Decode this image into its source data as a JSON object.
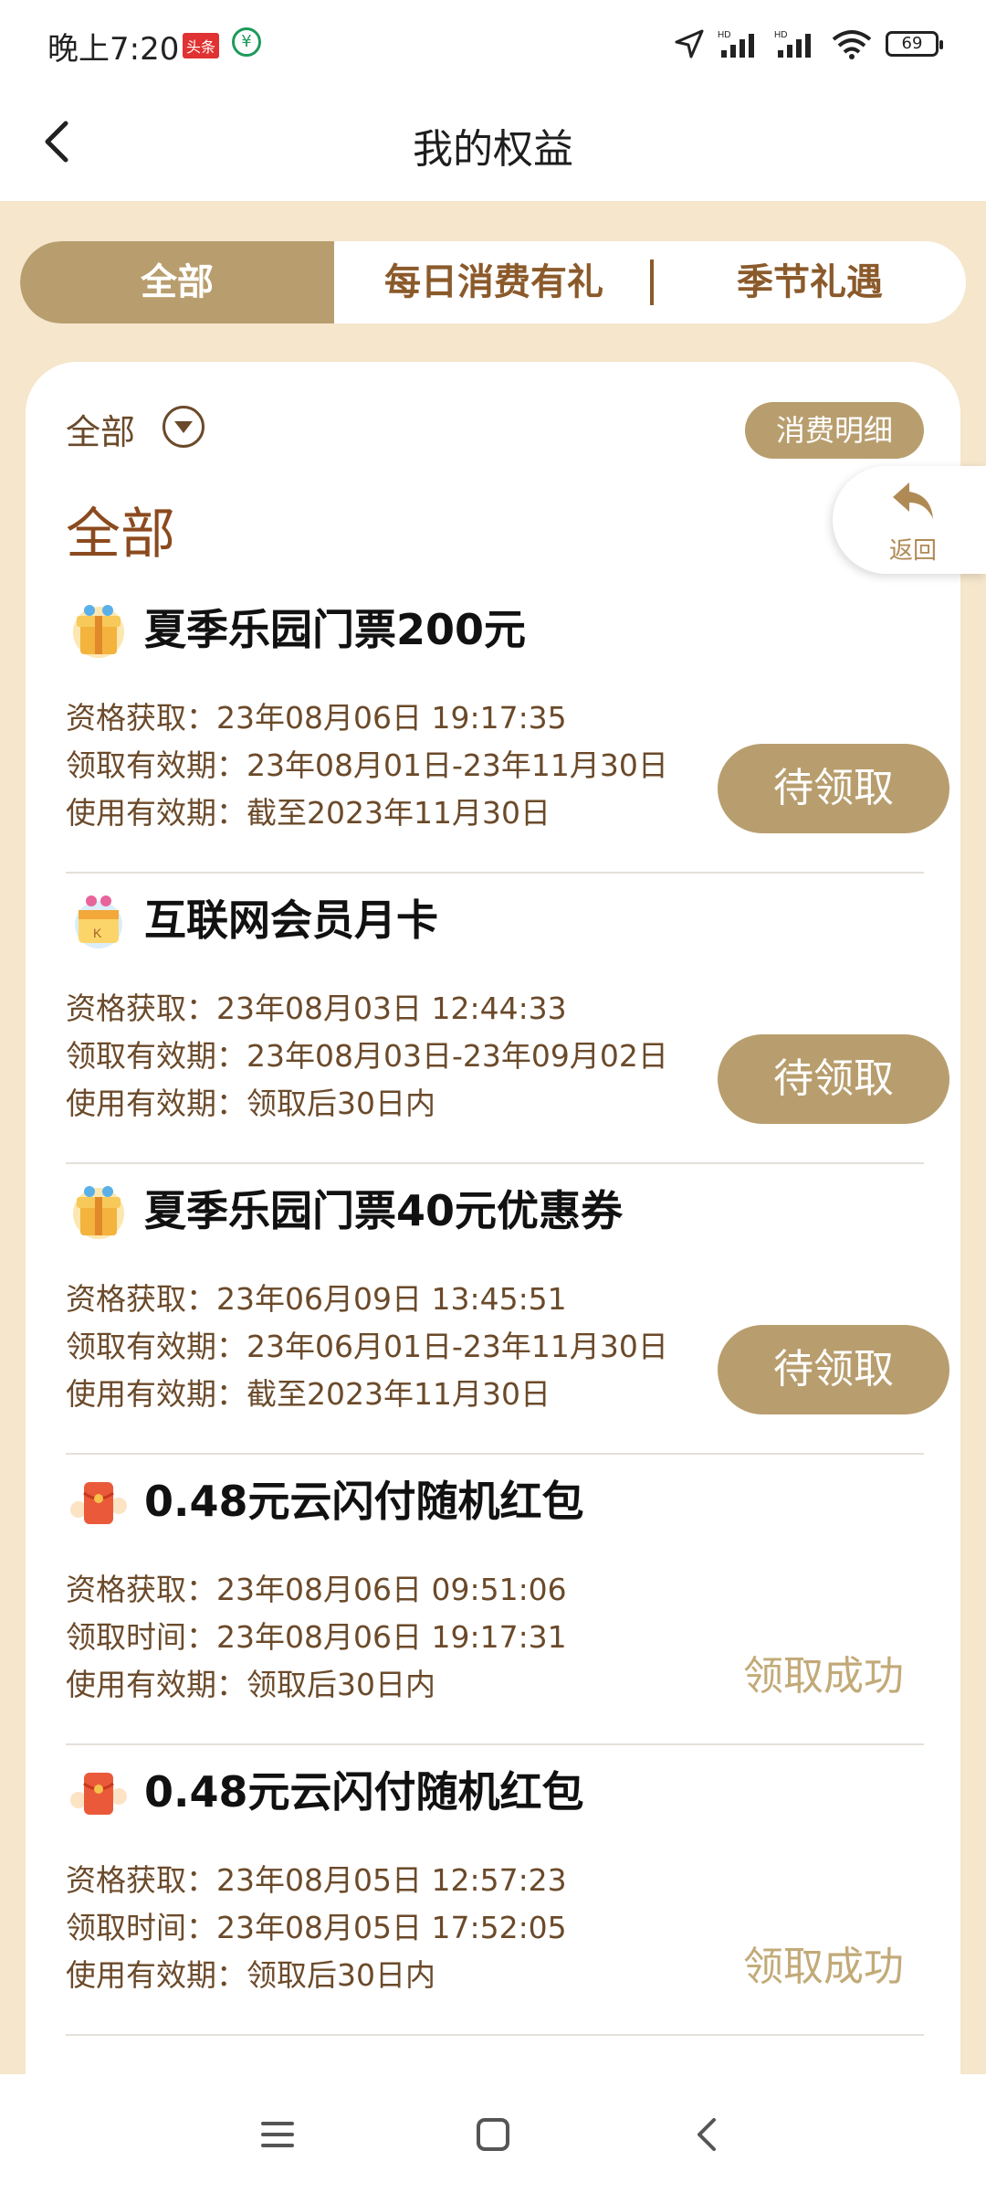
{
  "status_bar": {
    "time": "晚上7:20",
    "badge": "头条",
    "battery": "69"
  },
  "header": {
    "title": "我的权益"
  },
  "tabs": [
    {
      "label": "全部",
      "active": true
    },
    {
      "label": "每日消费有礼",
      "active": false
    },
    {
      "label": "季节礼遇",
      "active": false
    }
  ],
  "filter": {
    "selected": "全部",
    "detail_button": "消费明细"
  },
  "section_title": "全部",
  "float_return": {
    "label": "返回"
  },
  "items": [
    {
      "icon": "gift-box-icon",
      "title": "夏季乐园门票200元",
      "lines": [
        "资格获取：23年08月06日 19:17:35",
        "领取有效期：23年08月01日-23年11月30日",
        "使用有效期：截至2023年11月30日"
      ],
      "action": "待领取",
      "state": "pending"
    },
    {
      "icon": "member-card-icon",
      "title": "互联网会员月卡",
      "lines": [
        "资格获取：23年08月03日 12:44:33",
        "领取有效期：23年08月03日-23年09月02日",
        "使用有效期：领取后30日内"
      ],
      "action": "待领取",
      "state": "pending"
    },
    {
      "icon": "gift-box-icon",
      "title": "夏季乐园门票40元优惠券",
      "lines": [
        "资格获取：23年06月09日 13:45:51",
        "领取有效期：23年06月01日-23年11月30日",
        "使用有效期：截至2023年11月30日"
      ],
      "action": "待领取",
      "state": "pending"
    },
    {
      "icon": "red-packet-icon",
      "title": "0.48元云闪付随机红包",
      "lines": [
        "资格获取：23年08月06日 09:51:06",
        "领取时间：23年08月06日 19:17:31",
        "使用有效期：领取后30日内"
      ],
      "action": "领取成功",
      "state": "claimed"
    },
    {
      "icon": "red-packet-icon",
      "title": "0.48元云闪付随机红包",
      "lines": [
        "资格获取：23年08月05日 12:57:23",
        "领取时间：23年08月05日 17:52:05",
        "使用有效期：领取后30日内"
      ],
      "action": "领取成功",
      "state": "claimed"
    }
  ],
  "colors": {
    "accent": "#b89e6e",
    "brown": "#6b4a2a",
    "beige": "#f5e6cc",
    "title_brown": "#8b4a1e"
  }
}
